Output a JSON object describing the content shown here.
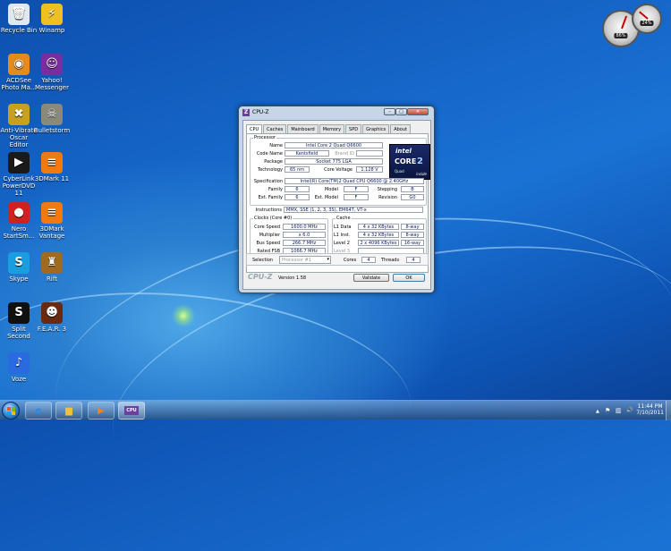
{
  "desktop": {
    "icons": [
      {
        "label": "Recycle Bin",
        "icon": "recycle-bin-icon",
        "glyph": "🗑",
        "color": "#dfe8f0"
      },
      {
        "label": "Winamp",
        "icon": "winamp-icon",
        "glyph": "⚡",
        "color": "#f0c020"
      },
      {
        "label": "ACDSee Photo Ma...",
        "icon": "acdsee-icon",
        "glyph": "◉",
        "color": "#e68a1c"
      },
      {
        "label": "Yahoo! Messenger",
        "icon": "yahoo-messenger-icon",
        "glyph": "☺",
        "color": "#7b2da0"
      },
      {
        "label": "Anti-Vibrate Oscar Editor",
        "icon": "oscar-editor-icon",
        "glyph": "✖",
        "color": "#c8a020"
      },
      {
        "label": "Bulletstorm",
        "icon": "bulletstorm-icon",
        "glyph": "☠",
        "color": "#8a8a7a"
      },
      {
        "label": "CyberLink PowerDVD 11",
        "icon": "powerdvd-icon",
        "glyph": "▶",
        "color": "#1a1a1a"
      },
      {
        "label": "3DMark 11",
        "icon": "3dmark11-icon",
        "glyph": "≡",
        "color": "#f07a10"
      },
      {
        "label": "Nero StartSm...",
        "icon": "nero-icon",
        "glyph": "●",
        "color": "#d02020"
      },
      {
        "label": "3DMark Vantage",
        "icon": "3dmark-vantage-icon",
        "glyph": "≡",
        "color": "#f07a10"
      },
      {
        "label": "Skype",
        "icon": "skype-icon",
        "glyph": "S",
        "color": "#1a9ee0"
      },
      {
        "label": "Rift",
        "icon": "rift-icon",
        "glyph": "♜",
        "color": "#a06a20"
      },
      {
        "label": "Split Second",
        "icon": "split-second-icon",
        "glyph": "S",
        "color": "#101010"
      },
      {
        "label": "F.E.A.R. 3",
        "icon": "fear3-icon",
        "glyph": "☻",
        "color": "#6a2a10"
      },
      {
        "label": "Voze",
        "icon": "voze-icon",
        "glyph": "♪",
        "color": "#2a6ae0"
      }
    ],
    "gadget_meter": {
      "cpu": "86%",
      "ram": "24%"
    }
  },
  "cpuz": {
    "title": "CPU-Z",
    "logo_glyph": "Z",
    "controls": {
      "minimize": "–",
      "maximize": "□",
      "close": "✕"
    },
    "tabs": [
      "CPU",
      "Caches",
      "Mainboard",
      "Memory",
      "SPD",
      "Graphics",
      "About"
    ],
    "active_tab": "CPU",
    "processor": {
      "group_label": "Processor",
      "name_label": "Name",
      "name": "Intel Core 2 Quad Q6600",
      "codename_label": "Code Name",
      "codename": "Kentsfield",
      "brandid_label": "Brand ID",
      "brandid": "",
      "package_label": "Package",
      "package": "Socket 775 LGA",
      "technology_label": "Technology",
      "technology": "65 nm",
      "core_voltage_label": "Core Voltage",
      "core_voltage": "1.128 V",
      "spec_label": "Specification",
      "spec": "Intel(R) Core(TM)2 Quad CPU    Q6600  @ 2.40GHz",
      "family_label": "Family",
      "family": "6",
      "model_label": "Model",
      "model": "F",
      "stepping_label": "Stepping",
      "stepping": "B",
      "ext_family_label": "Ext. Family",
      "ext_family": "6",
      "ext_model_label": "Ext. Model",
      "ext_model": "F",
      "revision_label": "Revision",
      "revision": "G0",
      "instructions_label": "Instructions",
      "instructions": "MMX, SSE (1, 2, 3, 3S), EM64T, VT-x"
    },
    "intel_logo": {
      "brand": "intel",
      "line": "CORE",
      "digit": "2",
      "sub": "Quad",
      "inside": "inside"
    },
    "clocks": {
      "group_label": "Clocks (Core #0)",
      "core_speed_label": "Core Speed",
      "core_speed": "1600.0 MHz",
      "multiplier_label": "Multiplier",
      "multiplier": "x 6.0",
      "bus_speed_label": "Bus Speed",
      "bus_speed": "266.7 MHz",
      "rated_fsb_label": "Rated FSB",
      "rated_fsb": "1066.7 MHz"
    },
    "cache": {
      "group_label": "Cache",
      "l1d_label": "L1 Data",
      "l1d": "4 x 32 KBytes",
      "l1d_way": "8-way",
      "l1i_label": "L1 Inst.",
      "l1i": "4 x 32 KBytes",
      "l1i_way": "8-way",
      "l2_label": "Level 2",
      "l2": "2 x 4096 KBytes",
      "l2_way": "16-way",
      "l3_label": "Level 3",
      "l3": ""
    },
    "selection": {
      "label": "Selection",
      "value": "Processor #1",
      "cores_label": "Cores",
      "cores": "4",
      "threads_label": "Threads",
      "threads": "4"
    },
    "footer": {
      "brand": "CPU-Z",
      "version": "Version 1.58",
      "validate": "Validate",
      "ok": "OK"
    }
  },
  "taskbar": {
    "start_colors": [
      "#f25022",
      "#7fba00",
      "#00a4ef",
      "#ffb900"
    ],
    "pinned": [
      {
        "name": "internet-explorer-icon",
        "glyph": "e",
        "color": "#2a8ae0"
      },
      {
        "name": "windows-explorer-icon",
        "glyph": "▆",
        "color": "#f0c040"
      },
      {
        "name": "media-player-icon",
        "glyph": "▶",
        "color": "#f08020"
      },
      {
        "name": "cpuz-taskbar-icon",
        "glyph": "CPU",
        "color": "#6b3fa0"
      }
    ],
    "tray": {
      "flag": "⚑",
      "speaker": "🔊",
      "network": "▥",
      "chevron": "▲"
    },
    "time": "11:44 PM",
    "date": "7/10/2011"
  }
}
